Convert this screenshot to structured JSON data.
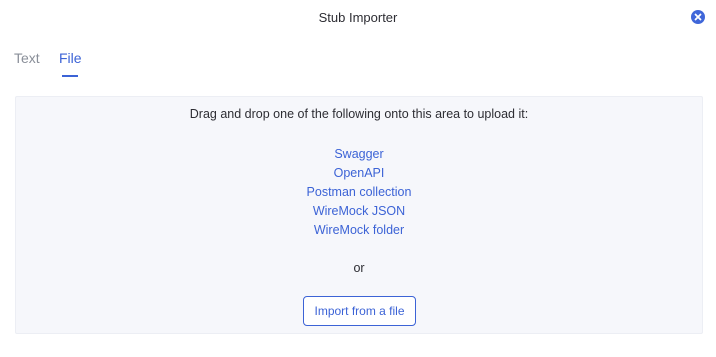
{
  "dialog": {
    "title": "Stub Importer",
    "close_icon": "close-circle-icon"
  },
  "tabs": [
    {
      "label": "Text",
      "active": false
    },
    {
      "label": "File",
      "active": true
    }
  ],
  "dropzone": {
    "instruction": "Drag and drop one of the following onto this area to upload it:",
    "formats": [
      "Swagger",
      "OpenAPI",
      "Postman collection",
      "WireMock JSON",
      "WireMock folder"
    ],
    "or_text": "or",
    "import_button": "Import from a file"
  },
  "colors": {
    "accent": "#3c63d6",
    "dropzone_bg": "#f6f7fb",
    "inactive_tab": "#8a8f99"
  }
}
